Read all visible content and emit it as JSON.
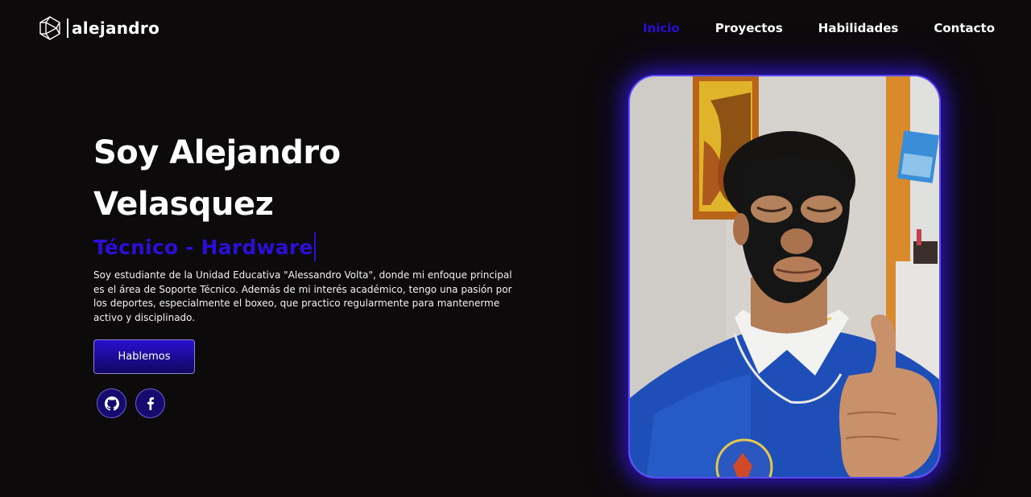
{
  "header": {
    "logo_text": "alejandro",
    "logo_icon": "geometric-logo-icon",
    "nav": [
      {
        "label": "Inicio",
        "active": true
      },
      {
        "label": "Proyectos",
        "active": false
      },
      {
        "label": "Habilidades",
        "active": false
      },
      {
        "label": "Contacto",
        "active": false
      }
    ]
  },
  "hero": {
    "title_line1": "Soy Alejandro",
    "title_line2": "Velasquez",
    "subtitle": "Técnico - Hardware",
    "description": "Soy estudiante de la Unidad Educativa \"Alessandro Volta\", donde mi enfoque principal es el área de Soporte Técnico. Además de mi interés académico, tengo una pasión por los deportes, especialmente el boxeo, que practico regularmente para mantenerme activo y disciplinado.",
    "cta_label": "Hablemos",
    "socials": [
      {
        "icon": "github-icon"
      },
      {
        "icon": "facebook-icon"
      }
    ]
  },
  "colors": {
    "accent": "#2a10d6",
    "background": "#0d0a0b",
    "glow": "#3c1eff"
  }
}
